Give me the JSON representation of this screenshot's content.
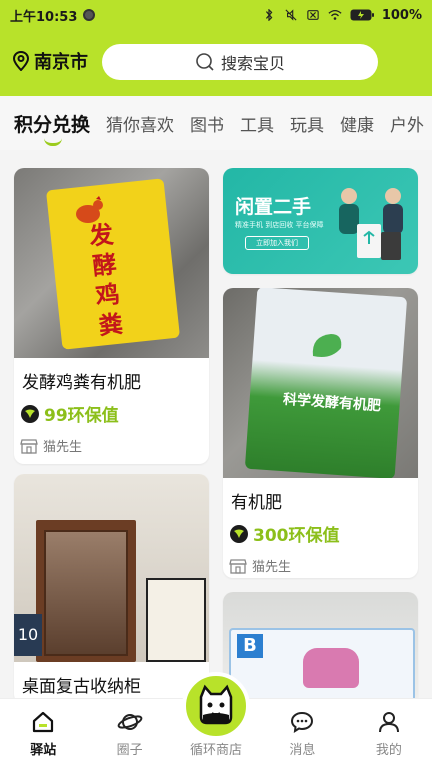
{
  "status": {
    "time": "上午10:53",
    "battery": "100%"
  },
  "header": {
    "city": "南京市",
    "search_placeholder": "搜索宝贝"
  },
  "tabs": [
    {
      "label": "积分兑换"
    },
    {
      "label": "猜你喜欢"
    },
    {
      "label": "图书"
    },
    {
      "label": "工具"
    },
    {
      "label": "玩具"
    },
    {
      "label": "健康"
    },
    {
      "label": "户外"
    }
  ],
  "banner": {
    "title": "闲置二手",
    "sub": "精准手机 到店回收 平台保障",
    "btn": "立即加入我们"
  },
  "products": [
    {
      "title": "发酵鸡粪有机肥",
      "price": "99环保值",
      "seller": "猫先生",
      "bag_text": "发酵鸡粪"
    },
    {
      "title": "有机肥",
      "price": "300环保值",
      "seller": "猫先生",
      "bag_text": "科学发酵有机肥"
    },
    {
      "title": "桌面复古收纳柜"
    },
    {
      "title": ""
    }
  ],
  "nav": [
    {
      "label": "驿站",
      "icon": "home-icon"
    },
    {
      "label": "圈子",
      "icon": "planet-icon"
    },
    {
      "label": "循环商店",
      "icon": "cat-logo-icon"
    },
    {
      "label": "消息",
      "icon": "chat-icon"
    },
    {
      "label": "我的",
      "icon": "user-icon"
    }
  ],
  "colors": {
    "brand": "#b8e22a",
    "price": "#8cbf1a"
  }
}
